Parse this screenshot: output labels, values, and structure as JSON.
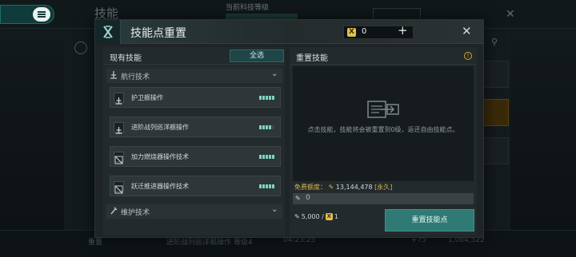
{
  "background": {
    "title": "技能",
    "tech_level_label": "当前科技等级",
    "bottom_status": "进阶战列巡洋舰操作 等级4",
    "bottom_time": "04:23:25",
    "bottom_label": "重置",
    "bottom_count": "+75",
    "bottom_value": "1,084,522"
  },
  "modal": {
    "title": "技能点重置",
    "currency_value": "0",
    "add_symbol": "+",
    "close_symbol": "✕",
    "left": {
      "title": "现有技能",
      "select_all": "全选",
      "categories": [
        {
          "label": "航行技术",
          "icon": "ship-category-icon",
          "skills": [
            {
              "label": "护卫舰操作",
              "level": 5
            },
            {
              "label": "进阶战列巡洋舰操作",
              "level": 4
            },
            {
              "label": "加力燃烧器操作技术",
              "level": 5
            },
            {
              "label": "跃迁推进器操作技术",
              "level": 5
            }
          ]
        },
        {
          "label": "维护技术",
          "icon": "wrench-category-icon",
          "skills": []
        }
      ]
    },
    "right": {
      "title": "重置技能",
      "info_symbol": "!",
      "empty_text": "点击技能，技能将会被重置到0级，返还自由技能点。",
      "free_quota_label": "免费额度：",
      "free_quota_value": "13,144,478",
      "free_quota_tag": "[永久]",
      "input_value": "0",
      "cost_value": "5,000 /",
      "cost_count": "1",
      "reset_button": "重置技能点"
    }
  },
  "colors": {
    "accent": "#2f7a74",
    "gold": "#e2c24c",
    "pip_on": "#7fd3c6"
  }
}
